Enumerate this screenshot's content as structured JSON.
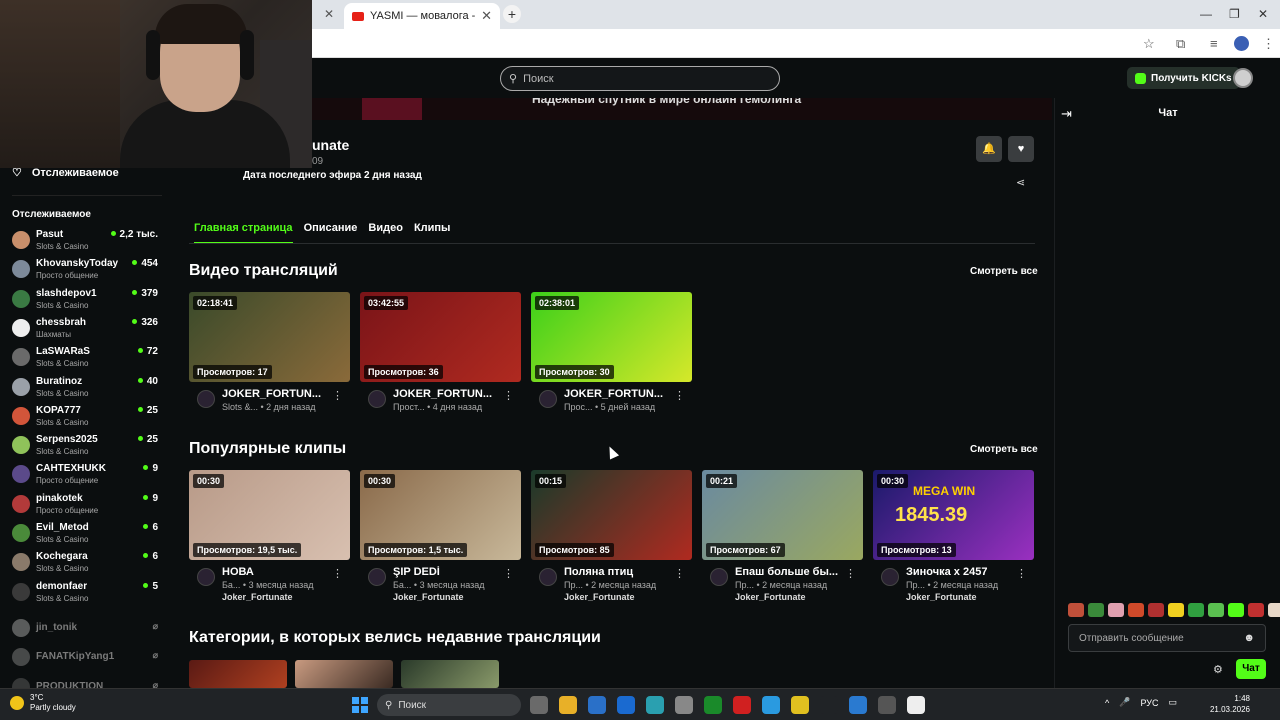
{
  "browser": {
    "tab_title": "YASMI — мовалога - YouTube",
    "tab_close": "✕",
    "new_tab": "+",
    "prev_tab_close": "✕",
    "win_min": "—",
    "win_max": "❐",
    "win_close": "✕"
  },
  "header": {
    "search_placeholder": "Поиск",
    "kicks_label": "Получить KICKs",
    "banner_text": "Надежный спутник в мире онлайн гемблинга"
  },
  "channel": {
    "name_visible": "unate",
    "followers_visible": "09",
    "last_stream": "Дата последнего эфира 2 дня назад"
  },
  "tabs": [
    "Главная страница",
    "Описание",
    "Видео",
    "Клипы"
  ],
  "sidebar": {
    "favorites_label": "Отслеживаемое",
    "section_title": "Отслеживаемое",
    "channels": [
      {
        "name": "Pasut",
        "category": "Slots & Casino",
        "viewers": "2,2 тыс.",
        "color": "#c98f6b"
      },
      {
        "name": "KhovanskyToday",
        "category": "Просто общение",
        "viewers": "454",
        "color": "#7d8a9a"
      },
      {
        "name": "slashdepov1",
        "category": "Slots & Casino",
        "viewers": "379",
        "color": "#3a7a43"
      },
      {
        "name": "chessbrah",
        "category": "Шахматы",
        "viewers": "326",
        "color": "#eeeeee"
      },
      {
        "name": "LaSWARaS",
        "category": "Slots & Casino",
        "viewers": "72",
        "color": "#6a6a6a"
      },
      {
        "name": "Buratinoz",
        "category": "Slots & Casino",
        "viewers": "40",
        "color": "#9aa0a8"
      },
      {
        "name": "KOPA777",
        "category": "Slots & Casino",
        "viewers": "25",
        "color": "#d2553a"
      },
      {
        "name": "Serpens2025",
        "category": "Slots & Casino",
        "viewers": "25",
        "color": "#8fc25a"
      },
      {
        "name": "CAHTEXHUKK",
        "category": "Просто общение",
        "viewers": "9",
        "color": "#5b4a8a"
      },
      {
        "name": "pinakotek",
        "category": "Просто общение",
        "viewers": "9",
        "color": "#b23a3a"
      },
      {
        "name": "Evil_Metod",
        "category": "Slots & Casino",
        "viewers": "6",
        "color": "#4a8a3a"
      },
      {
        "name": "Kochegara",
        "category": "Slots & Casino",
        "viewers": "6",
        "color": "#8a7a6a"
      },
      {
        "name": "demonfaer",
        "category": "Slots & Casino",
        "viewers": "5",
        "color": "#3a3a3a"
      }
    ],
    "offline": [
      {
        "name": "jin_tonik",
        "color": "#9a9a9a"
      },
      {
        "name": "FANATKipYang1",
        "color": "#7a7a7a"
      },
      {
        "name": "PRODUKTION",
        "color": "#5a5a5a"
      }
    ]
  },
  "videos": {
    "title": "Видео трансляций",
    "see_all": "Смотреть все",
    "items": [
      {
        "duration": "02:18:41",
        "views": "Просмотров: 17",
        "title": "JOKER_FORTUN...",
        "meta": "Slots &... • 2 дня назад",
        "c1": "#3a4a2a",
        "c2": "#8a6a3a"
      },
      {
        "duration": "03:42:55",
        "views": "Просмотров: 36",
        "title": "JOKER_FORTUN...",
        "meta": "Прост... • 4 дня назад",
        "c1": "#7a1418",
        "c2": "#b02a20"
      },
      {
        "duration": "02:38:01",
        "views": "Просмотров: 30",
        "title": "JOKER_FORTUN...",
        "meta": "Прос... • 5 дней назад",
        "c1": "#3cd01a",
        "c2": "#d6e82a"
      }
    ]
  },
  "clips": {
    "title": "Популярные клипы",
    "see_all": "Смотреть все",
    "items": [
      {
        "duration": "00:30",
        "views": "Просмотров: 19,5 тыс.",
        "title": "НОВА",
        "meta": "Ба... • 3 месяца назад",
        "author": "Joker_Fortunate",
        "c1": "#b89a88",
        "c2": "#d8c0b0"
      },
      {
        "duration": "00:30",
        "views": "Просмотров: 1,5 тыс.",
        "title": "ŞIP DEDİ",
        "meta": "Ба... • 3 месяца назад",
        "author": "Joker_Fortunate",
        "c1": "#8a6a4a",
        "c2": "#c8b89a"
      },
      {
        "duration": "00:15",
        "views": "Просмотров: 85",
        "title": "Поляна птиц",
        "meta": "Пр... • 2 месяца назад",
        "author": "Joker_Fortunate",
        "c1": "#1a3a2a",
        "c2": "#b02a20"
      },
      {
        "duration": "00:21",
        "views": "Просмотров: 67",
        "title": "Епаш больше бы...",
        "meta": "Пр... • 2 месяца назад",
        "author": "Joker_Fortunate",
        "c1": "#6a8aa0",
        "c2": "#9aa860"
      },
      {
        "duration": "00:30",
        "views": "Просмотров: 13",
        "title": "Зиночка х 2457",
        "meta": "Пр... • 2 месяца назад",
        "author": "Joker_Fortunate",
        "c1": "#1a1a6a",
        "c2": "#9a30c0",
        "overlay_top": "MEGA WIN",
        "overlay_num": "1845.39"
      }
    ]
  },
  "categories": {
    "title": "Категории, в которых велись недавние трансляции"
  },
  "chat": {
    "title": "Чат",
    "message_placeholder": "Отправить сообщение",
    "send_label": "Чат"
  },
  "taskbar": {
    "temp": "3°C",
    "weather": "Partly cloudy",
    "search_label": "Поиск",
    "lang": "РУС",
    "time": "1:48",
    "date": "21.03.2026"
  },
  "colors": {
    "accent": "#53fc18",
    "bg": "#0b0e0f"
  }
}
